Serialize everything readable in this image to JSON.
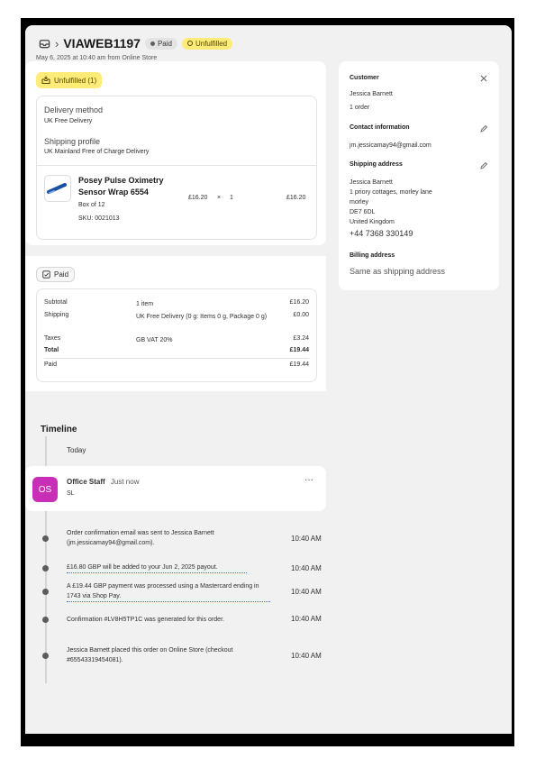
{
  "header": {
    "order_number": "VIAWEB1197",
    "paid_badge": "Paid",
    "unfulfilled_badge": "Unfulfilled",
    "sub": "May 6, 2025 at 10:40 am from Online Store"
  },
  "fulfillment": {
    "badge": "Unfulfilled (1)",
    "delivery_label": "Delivery method",
    "delivery_value": "UK Free Delivery",
    "profile_label": "Shipping profile",
    "profile_value": "UK Mainland Free of Charge Delivery",
    "item": {
      "name": "Posey Pulse Oximetry Sensor Wrap 6554",
      "variant": "Box of 12",
      "sku": "SKU: 0021013",
      "price": "£16.20",
      "times": "×",
      "qty": "1",
      "total": "£16.20"
    }
  },
  "payment": {
    "tag": "Paid",
    "rows": [
      {
        "label": "Subtotal",
        "desc": "1 item",
        "amount": "£16.20"
      },
      {
        "label": "Shipping",
        "desc": "UK Free Delivery (0 g: Items 0 g, Package 0 g)",
        "amount": "£0.00"
      },
      {
        "label": "Taxes",
        "desc": "GB VAT 20%",
        "amount": "£3.24"
      },
      {
        "label": "Total",
        "desc": "",
        "amount": "£19.44"
      },
      {
        "label": "Paid",
        "desc": "",
        "amount": "£19.44"
      }
    ]
  },
  "customer": {
    "heading": "Customer",
    "name": "Jessica Barnett",
    "orders": "1 order",
    "contact_heading": "Contact information",
    "email": "jm.jessicamay94@gmail.com",
    "shipping_heading": "Shipping address",
    "address_lines": [
      "Jessica Barnett",
      "1 priory cottages, morley lane",
      "morley",
      "DE7 6DL",
      "United Kingdom"
    ],
    "phone": "+44 7368 330149",
    "billing_heading": "Billing address",
    "billing_value": "Same as shipping address"
  },
  "timeline": {
    "title": "Timeline",
    "today": "Today",
    "comment": {
      "avatar": "OS",
      "author": "Office Staff",
      "time": "Just now",
      "body": "SL",
      "menu": "···"
    },
    "events": [
      {
        "text": "Order confirmation email was sent to Jessica Barnett (jm.jessicamay94@gmail.com).",
        "time": "10:40 AM"
      },
      {
        "text": "£16.80 GBP will be added to your Jun 2, 2025 payout.",
        "time": "10:40 AM"
      },
      {
        "text": "A £19.44 GBP payment was processed using a Mastercard ending in 1743 via Shop Pay.",
        "time": "10:40 AM"
      },
      {
        "text": "Confirmation #LV8H5TP1C was generated for this order.",
        "time": "10:40 AM"
      },
      {
        "text": "Jessica Barnett placed this order on Online Store (checkout #65543319454081).",
        "time": "10:40 AM"
      }
    ]
  },
  "colors": {
    "unfulfilled": "#ffeb78",
    "avatar": "#c92fb6",
    "link": "#2c6ecb"
  }
}
